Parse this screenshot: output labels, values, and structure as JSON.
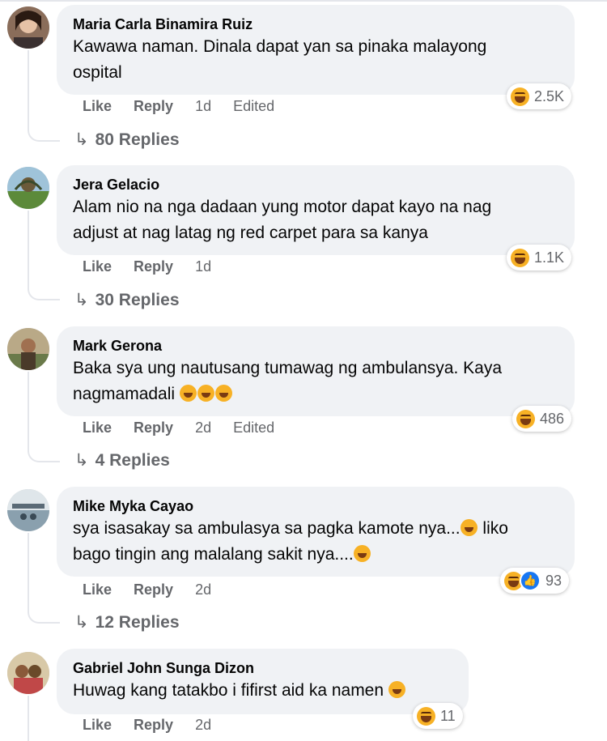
{
  "comments": [
    {
      "author": "Maria Carla Binamira Ruiz",
      "text_lines": [
        "Kawawa naman. Dinala dapat yan sa pinaka malayong",
        "ospital"
      ],
      "like": "Like",
      "reply": "Reply",
      "time": "1d",
      "edited": "Edited",
      "reaction_count": "2.5K",
      "reaction_icons": [
        "haha-icon"
      ],
      "replies": "80 Replies"
    },
    {
      "author": "Jera Gelacio",
      "text_lines": [
        "Alam nio na nga dadaan yung motor dapat kayo na nag",
        "adjust at nag latag ng red carpet para sa kanya"
      ],
      "like": "Like",
      "reply": "Reply",
      "time": "1d",
      "reaction_count": "1.1K",
      "reaction_icons": [
        "haha-icon"
      ],
      "replies": "30 Replies"
    },
    {
      "author": "Mark Gerona",
      "text_lines": [
        "Baka sya ung nautusang tumawag ng ambulansya. Kaya",
        "nagmamadali"
      ],
      "like": "Like",
      "reply": "Reply",
      "time": "2d",
      "edited": "Edited",
      "reaction_count": "486",
      "reaction_icons": [
        "haha-icon"
      ],
      "replies": "4 Replies"
    },
    {
      "author": "Mike Myka Cayao",
      "text_lines": [
        "sya isasakay sa ambulasya sa pagka kamote nya...",
        " liko",
        "bago tingin ang malalang sakit nya...."
      ],
      "like": "Like",
      "reply": "Reply",
      "time": "2d",
      "reaction_count": "93",
      "reaction_icons": [
        "haha-icon",
        "like-icon"
      ],
      "replies": "12 Replies"
    },
    {
      "author": "Gabriel John Sunga Dizon",
      "text_lines": [
        "Huwag kang tatakbo i fifirst aid ka namen"
      ],
      "like": "Like",
      "reply": "Reply",
      "time": "2d",
      "reaction_count": "11",
      "reaction_icons": [
        "haha-icon"
      ]
    }
  ],
  "colors": {
    "bubble": "#f0f2f5",
    "meta": "#65676b",
    "haha": "#f7b125",
    "like": "#1877f2"
  }
}
